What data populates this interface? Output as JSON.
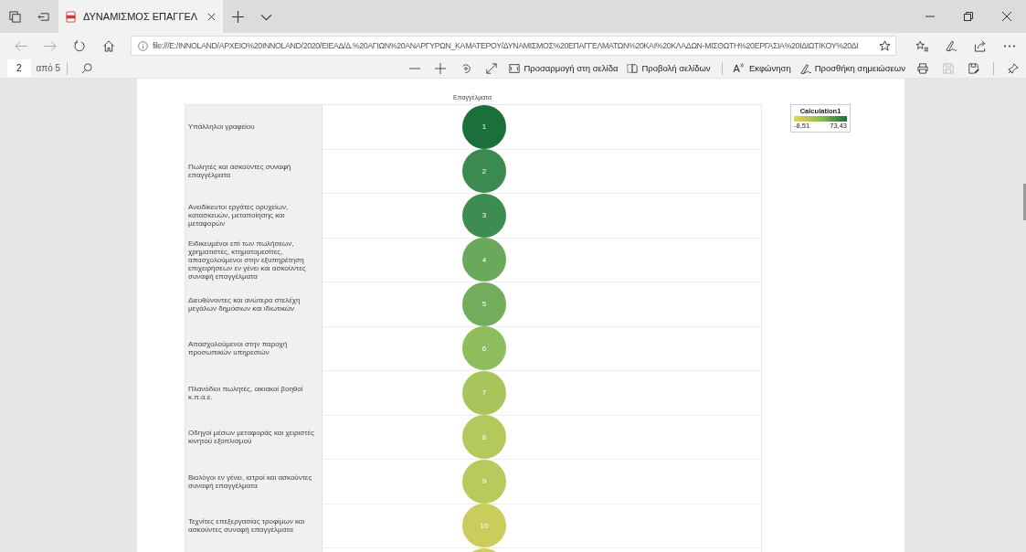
{
  "browser": {
    "tab_title": "ΔΥΝΑΜΙΣΜΟΣ ΕΠΑΓΓΕΛ",
    "address": "file:///E:/INNOLAND/ΑΡΧΕΙΟ%20INNOLAND/2020/ΕΙΕΑΔ/Δ.%20ΑΓΙΩΝ%20ΑΝΑΡΓΥΡΩΝ_ΚΑΜΑΤΕΡΟΥ/ΔΥΝΑΜΙΣΜΟΣ%20ΕΠΑΓΓΕΛΜΑΤΩΝ%20ΚΑΙ%20ΚΛΑΔΩΝ-ΜΙΣΘΩΤΗ%20ΕΡΓΑΣΙΑ%20ΙΔΙΩΤΙΚΟΥ%20ΔΙ"
  },
  "pdf_toolbar": {
    "page": "2",
    "page_count": "από 5",
    "buttons": [
      {
        "kind": "fit",
        "label": "Προσαρμογή στη σελίδα"
      },
      {
        "kind": "pages",
        "label": "Προβολή σελίδων"
      },
      {
        "kind": "read",
        "glyph": "A",
        "label": "Εκφώνηση"
      },
      {
        "kind": "notes",
        "label": "Προσθήκη σημειώσεων"
      }
    ],
    "save_disabled": true
  },
  "chart": {
    "header": "Επαγγέλματα",
    "legend": {
      "title": "Calculation1",
      "min": "-8,51",
      "max": "73,43"
    },
    "rows": [
      {
        "label": "Υπάλληλοι γραφείου",
        "rank": "1",
        "color": "#1b6f3b"
      },
      {
        "label": "Πωλητές και ασκούντες συναφή επαγγέλματα",
        "rank": "2",
        "color": "#3a8a51"
      },
      {
        "label": "Ανειδίκευτοι εργάτες ορυχείων, κατασκευών, μεταποίησης και μεταφορών",
        "rank": "3",
        "color": "#3d8c52"
      },
      {
        "label": "Ειδικευμένοι επί των πωλήσεων, χρηματιστές, κτηματομεσίτες, απασχολούμενοι στην εξυπηρέτηση επιχειρήσεων εν γένει και ασκούντες συναφή επαγγέλματα",
        "rank": "4",
        "color": "#6aa95b"
      },
      {
        "label": "Διευθύνοντες και ανώτερα στελέχη μεγάλων δημόσιων και ιδιωτικών",
        "rank": "5",
        "color": "#72ad5c"
      },
      {
        "label": "Απασχολούμενοι στην παροχή προσωπικών υπηρεσιών",
        "rank": "6",
        "color": "#8dbd5d"
      },
      {
        "label": "Πλανόδιοι πωλητές, οικιακοί βοηθοί κ.π.α.ε.",
        "rank": "7",
        "color": "#a8c55b"
      },
      {
        "label": "Οδηγοί μέσων μεταφοράς και χειριστές κινητού εξοπλισμού",
        "rank": "8",
        "color": "#b3c95b"
      },
      {
        "label": "Βιολόγοι εν γένει, ιατροί και ασκούντες συναφή επαγγέλματα",
        "rank": "9",
        "color": "#b8ca5b"
      },
      {
        "label": "Τεχνίτες επεξεργασίας τροφίμων και ασκούντες συναφή επαγγέλματα",
        "rank": "10",
        "color": "#c8cd5c"
      },
      {
        "color": "#d0cf5e"
      }
    ]
  }
}
